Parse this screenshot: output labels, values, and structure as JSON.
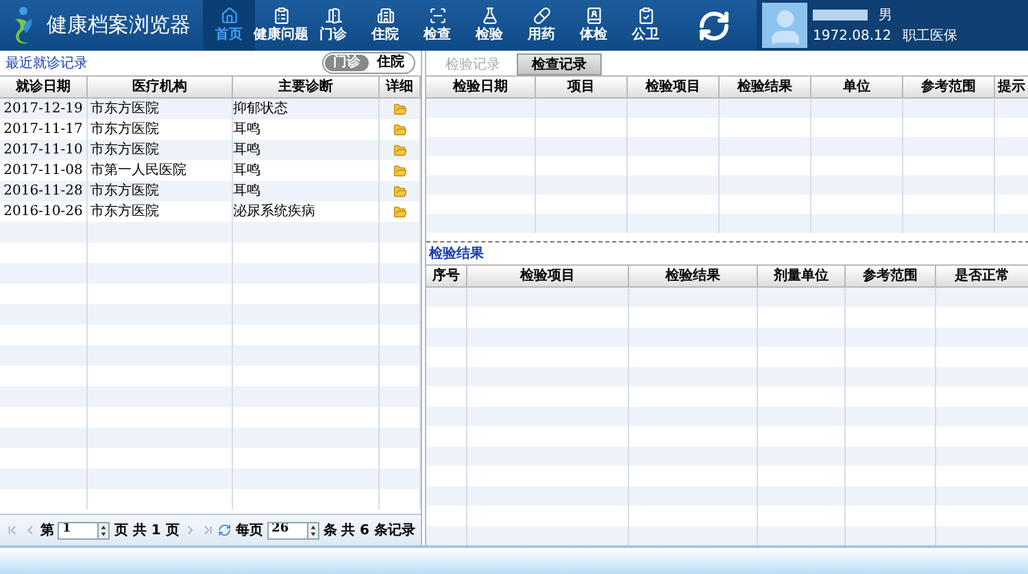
{
  "app": {
    "title": "健康档案浏览器"
  },
  "nav": [
    {
      "label": "首页",
      "selected": true
    },
    {
      "label": "健康问题",
      "selected": false
    },
    {
      "label": "门诊",
      "selected": false
    },
    {
      "label": "住院",
      "selected": false
    },
    {
      "label": "检查",
      "selected": false
    },
    {
      "label": "检验",
      "selected": false
    },
    {
      "label": "用药",
      "selected": false
    },
    {
      "label": "体检",
      "selected": false
    },
    {
      "label": "公卫",
      "selected": false
    }
  ],
  "patient": {
    "gender": "男",
    "birth_date": "1972.08.12",
    "insurance": "职工医保"
  },
  "visits": {
    "title": "最近就诊记录",
    "toggle": [
      {
        "label": "门诊",
        "selected": true
      },
      {
        "label": "住院",
        "selected": false
      }
    ],
    "columns": [
      "就诊日期",
      "医疗机构",
      "主要诊断",
      "详细"
    ],
    "rows": [
      {
        "date": "2017-12-19",
        "hospital": "市东方医院",
        "diagnosis": "抑郁状态"
      },
      {
        "date": "2017-11-17",
        "hospital": "市东方医院",
        "diagnosis": "耳鸣"
      },
      {
        "date": "2017-11-10",
        "hospital": "市东方医院",
        "diagnosis": "耳鸣"
      },
      {
        "date": "2017-11-08",
        "hospital": "市第一人民医院",
        "diagnosis": "耳鸣"
      },
      {
        "date": "2016-11-28",
        "hospital": "市东方医院",
        "diagnosis": "耳鸣"
      },
      {
        "date": "2016-10-26",
        "hospital": "市东方医院",
        "diagnosis": "泌尿系统疾病"
      }
    ],
    "pager": {
      "page_prefix": "第",
      "page": "1",
      "page_suffix": "页 共 1 页",
      "per_page_label": "每页",
      "per_page": "26",
      "per_page_suffix": "条",
      "total": "共 6 条记录"
    }
  },
  "records": {
    "tabs": [
      {
        "label": "检验记录",
        "selected": false
      },
      {
        "label": "检查记录",
        "selected": true
      }
    ],
    "columns": [
      "检验日期",
      "项目",
      "检验项目",
      "检验结果",
      "单位",
      "参考范围",
      "提示"
    ]
  },
  "results": {
    "title": "检验结果",
    "columns": [
      "序号",
      "检验项目",
      "检验结果",
      "剂量单位",
      "参考范围",
      "是否正常"
    ]
  }
}
